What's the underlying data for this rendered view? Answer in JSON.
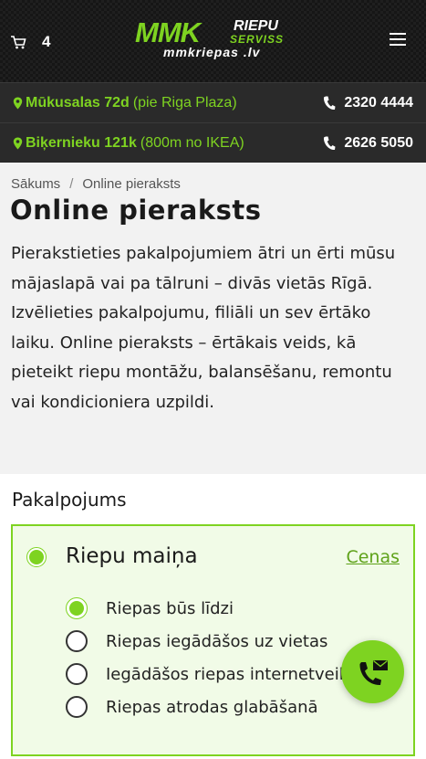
{
  "header": {
    "cart_count": "4",
    "logo": {
      "mmk": "MMK",
      "riepu": "RIEPU",
      "serviss": "SERVISS",
      "url": "mmkriepas .lv"
    }
  },
  "locations": [
    {
      "street": "Mūkusalas 72d",
      "note": "(pie Riga Plaza)",
      "phone": "2320 4444"
    },
    {
      "street": "Biķernieku 121k",
      "note": "(800m no IKEA)",
      "phone": "2626 5050"
    }
  ],
  "breadcrumb": {
    "home": "Sākums",
    "separator": "/",
    "current": "Online pieraksts"
  },
  "page_title": "Online pieraksts",
  "intro": "Pierakstieties pakalpojumiem ātri un ērti mūsu mājaslapā vai pa tālruni – divās vietās Rīgā. Izvēlieties pakalpojumu, filiāli un sev ērtāko laiku. Online pieraksts – ērtākais veids, kā pieteikt riepu montāžu, balansēšanu, remontu vai kondicioniera uzpildi.",
  "service_section": {
    "title": "Pakalpojums",
    "service_name": "Riepu maiņa",
    "prices_link": "Cenas",
    "options": [
      {
        "label": "Riepas būs līdzi",
        "checked": true
      },
      {
        "label": "Riepas iegādāšos uz vietas",
        "checked": false
      },
      {
        "label": "Iegādāšos riepas internetveikalā",
        "checked": false
      },
      {
        "label": "Riepas atrodas glabāšanā",
        "checked": false
      }
    ]
  },
  "colors": {
    "accent": "#7ed321",
    "header_bg": "#161616",
    "location_bar": "#2a2a2a"
  },
  "icons": {
    "cart": "cart-icon",
    "menu": "hamburger-menu-icon",
    "pin": "map-pin-icon",
    "phone": "phone-icon",
    "fab": "phone-mail-icon"
  }
}
